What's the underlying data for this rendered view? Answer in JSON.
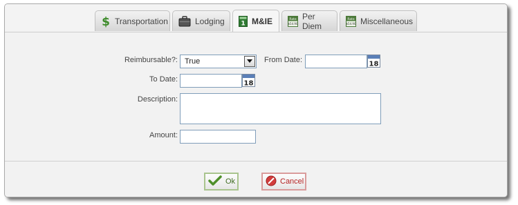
{
  "tabs": [
    {
      "label": "Transportation",
      "icon": "dollar-icon"
    },
    {
      "label": "Lodging",
      "icon": "briefcase-icon"
    },
    {
      "label": "M&IE",
      "icon": "calendar-day-icon"
    },
    {
      "label": "Per Diem",
      "icon": "rate-icon"
    },
    {
      "label": "Miscellaneous",
      "icon": "rate-icon"
    }
  ],
  "active_tab": "M&IE",
  "rate_icon_text": {
    "line1": "Rate",
    "line2": "$54.90"
  },
  "calendar_icon_day": "18",
  "mie_icon_day": "1",
  "form": {
    "reimbursable_label": "Reimbursable?:",
    "reimbursable_value": "True",
    "from_date_label": "From Date:",
    "from_date_value": "",
    "to_date_label": "To Date:",
    "to_date_value": "",
    "description_label": "Description:",
    "description_value": "",
    "amount_label": "Amount:",
    "amount_value": ""
  },
  "footer": {
    "ok_label": "Ok",
    "cancel_label": "Cancel"
  },
  "colors": {
    "ok_border": "#a9c48e",
    "cancel_border": "#d99b9b",
    "field_border": "#7f9db9"
  }
}
